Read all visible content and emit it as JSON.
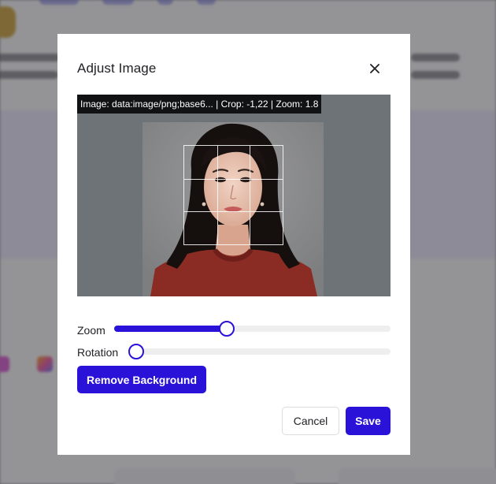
{
  "modal": {
    "title": "Adjust Image",
    "preview_info": "Image: data:image/png;base6... | Crop: -1,22 | Zoom: 1.8",
    "zoom_label": "Zoom",
    "zoom_value": 0.407,
    "rotation_label": "Rotation",
    "rotation_value": 0.0,
    "remove_background_label": "Remove Background",
    "cancel_label": "Cancel",
    "save_label": "Save"
  },
  "colors": {
    "accent": "#2b12d9",
    "overlay": "#3c3c40",
    "preview_bg": "#6e7378"
  },
  "icons": {
    "close": "close-icon"
  }
}
